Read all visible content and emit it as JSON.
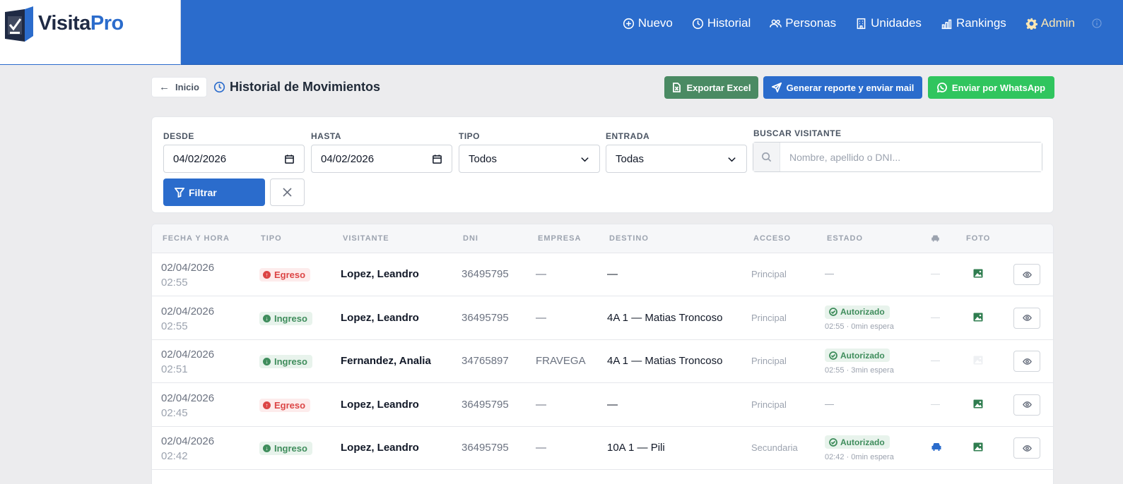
{
  "brand": {
    "name_part1": "Visita",
    "name_part2": "Pro"
  },
  "nav": {
    "items": [
      {
        "label": "Nuevo",
        "icon": "plus-circle-icon"
      },
      {
        "label": "Historial",
        "icon": "clock-icon"
      },
      {
        "label": "Personas",
        "icon": "users-icon"
      },
      {
        "label": "Unidades",
        "icon": "building-icon"
      },
      {
        "label": "Rankings",
        "icon": "bar-chart-icon"
      },
      {
        "label": "Admin",
        "icon": "gear-icon"
      }
    ],
    "admin_color": "#fde7b4"
  },
  "header": {
    "back_label": "Inicio",
    "title": "Historial de Movimientos",
    "export_label": "Exportar Excel",
    "report_label": "Generar reporte y enviar mail",
    "whatsapp_label": "Enviar por WhatsApp"
  },
  "filters": {
    "desde_label": "DESDE",
    "desde_value": "04/02/2026",
    "hasta_label": "HASTA",
    "hasta_value": "04/02/2026",
    "tipo_label": "TIPO",
    "tipo_value": "Todos",
    "entrada_label": "ENTRADA",
    "entrada_value": "Todas",
    "buscar_label": "BUSCAR VISITANTE",
    "buscar_placeholder": "Nombre, apellido o DNI...",
    "filter_label": "Filtrar"
  },
  "table": {
    "columns": {
      "fecha": "FECHA Y HORA",
      "tipo": "TIPO",
      "visitante": "VISITANTE",
      "dni": "DNI",
      "empresa": "EMPRESA",
      "destino": "DESTINO",
      "acceso": "ACCESO",
      "estado": "ESTADO",
      "foto": "FOTO"
    },
    "rows": [
      {
        "date": "02/04/2026",
        "time": "02:55",
        "tipo": "Egreso",
        "visitante": "Lopez, Leandro",
        "dni": "36495795",
        "empresa": "—",
        "destino": "—",
        "acceso": "Principal",
        "estado": "—",
        "estado_sub": "",
        "vehiculo": "—"
      },
      {
        "date": "02/04/2026",
        "time": "02:55",
        "tipo": "Ingreso",
        "visitante": "Lopez, Leandro",
        "dni": "36495795",
        "empresa": "—",
        "destino": "4A 1 — Matias Troncoso",
        "acceso": "Principal",
        "estado": "Autorizado",
        "estado_sub": "02:55 · 0min espera",
        "vehiculo": "—"
      },
      {
        "date": "02/04/2026",
        "time": "02:51",
        "tipo": "Ingreso",
        "visitante": "Fernandez, Analia",
        "dni": "34765897",
        "empresa": "FRAVEGA",
        "destino": "4A 1 — Matias Troncoso",
        "acceso": "Principal",
        "estado": "Autorizado",
        "estado_sub": "02:55 · 3min espera",
        "vehiculo": "—"
      },
      {
        "date": "02/04/2026",
        "time": "02:45",
        "tipo": "Egreso",
        "visitante": "Lopez, Leandro",
        "dni": "36495795",
        "empresa": "—",
        "destino": "—",
        "acceso": "Principal",
        "estado": "—",
        "estado_sub": "",
        "vehiculo": "—"
      },
      {
        "date": "02/04/2026",
        "time": "02:42",
        "tipo": "Ingreso",
        "visitante": "Lopez, Leandro",
        "dni": "36495795",
        "empresa": "—",
        "destino": "10A 1 — Pili",
        "acceso": "Secundaria",
        "estado": "Autorizado",
        "estado_sub": "02:42 · 0min espera",
        "vehiculo": "car-icon"
      }
    ]
  }
}
